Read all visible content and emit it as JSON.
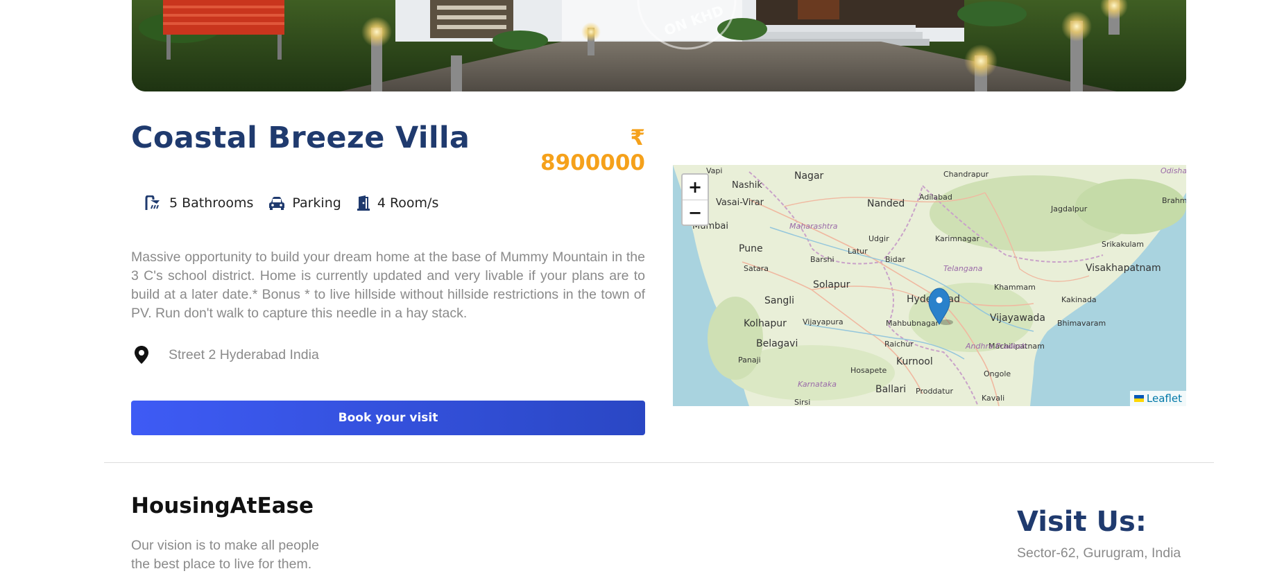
{
  "property": {
    "hero_watermark": "ON KHD",
    "title": "Coastal Breeze Villa",
    "price": "₹ 8900000",
    "features": [
      {
        "icon": "shower-icon",
        "label": "5 Bathrooms"
      },
      {
        "icon": "car-icon",
        "label": "Parking"
      },
      {
        "icon": "door-icon",
        "label": "4 Room/s"
      }
    ],
    "description": "Massive opportunity to build your dream home at the base of Mummy Mountain in the 3 C's school district. Home is currently updated and very livable if your plans are to build at a later date.* Bonus * to live hillside without hillside restrictions in the town of PV. Run don't walk to capture this needle in a hay stack.",
    "address": "Street 2 Hyderabad India",
    "book_button": "Book your visit"
  },
  "map": {
    "zoom_in": "+",
    "zoom_out": "−",
    "attribution": "Leaflet",
    "labels": [
      "Vapi",
      "Nashik",
      "Nagar",
      "Chandrapur",
      "Odisha",
      "Vasai-Virar",
      "Nanded",
      "Adilabad",
      "Brahm",
      "Mumbai",
      "Jagdalpur",
      "Maharashtra",
      "Udgir",
      "Karimnagar",
      "Pune",
      "Latur",
      "Srikakulam",
      "Barshi",
      "Bidar",
      "Satara",
      "Telangana",
      "Visakhapatnam",
      "Solapur",
      "Khammam",
      "Sangli",
      "Hyderabad",
      "Kakinada",
      "Vijayapura",
      "Vijayawada",
      "Kolhapur",
      "Mahbubnagar",
      "Bhimavaram",
      "Belagavi",
      "Raichur",
      "Machilipatnam",
      "Andhra Pradesh",
      "Panaji",
      "Kurnool",
      "Hosapete",
      "Ongole",
      "Karnataka",
      "Ballari",
      "Proddatur",
      "Kavali",
      "Sirsi"
    ]
  },
  "footer": {
    "brand": "HousingAtEase",
    "vision": "Our vision is to make all people the best place to live for them.",
    "visit_title": "Visit Us:",
    "visit_address": "Sector-62, Gurugram, India"
  },
  "colors": {
    "title": "#1f3a6e",
    "price": "#f5a11b",
    "button": "#3355ee",
    "map_marker": "#2a81cb"
  }
}
